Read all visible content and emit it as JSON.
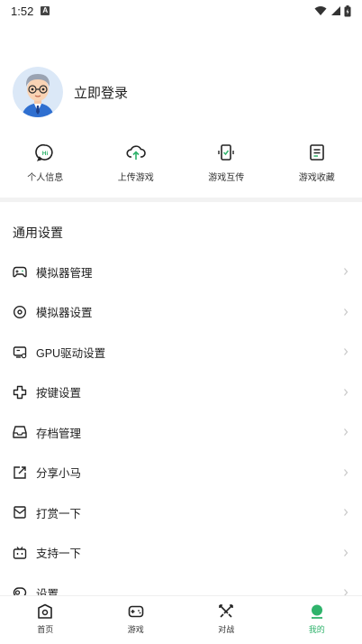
{
  "status_bar": {
    "time": "1:52",
    "notification_letter": "A"
  },
  "profile": {
    "login_label": "立即登录"
  },
  "quick_actions": [
    {
      "label": "个人信息",
      "icon": "profile-info-icon"
    },
    {
      "label": "上传游戏",
      "icon": "cloud-upload-icon"
    },
    {
      "label": "游戏互传",
      "icon": "transfer-icon"
    },
    {
      "label": "游戏收藏",
      "icon": "favorites-list-icon"
    }
  ],
  "settings": {
    "title": "通用设置",
    "items": [
      {
        "label": "模拟器管理",
        "icon": "gamepad-icon"
      },
      {
        "label": "模拟器设置",
        "icon": "gear-icon"
      },
      {
        "label": "GPU驱动设置",
        "icon": "gpu-icon"
      },
      {
        "label": "按键设置",
        "icon": "dpad-icon"
      },
      {
        "label": "存档管理",
        "icon": "save-tray-icon"
      },
      {
        "label": "分享小马",
        "icon": "share-icon"
      },
      {
        "label": "打赏一下",
        "icon": "mail-icon"
      },
      {
        "label": "支持一下",
        "icon": "tv-icon"
      },
      {
        "label": "设置",
        "icon": "settings-icon"
      }
    ]
  },
  "bottom_nav": {
    "active_color": "#2fb36b",
    "items": [
      {
        "label": "首页",
        "icon": "home-icon",
        "active": false
      },
      {
        "label": "游戏",
        "icon": "game-controller-icon",
        "active": false
      },
      {
        "label": "对战",
        "icon": "versus-icon",
        "active": false
      },
      {
        "label": "我的",
        "icon": "me-icon",
        "active": true
      }
    ]
  }
}
